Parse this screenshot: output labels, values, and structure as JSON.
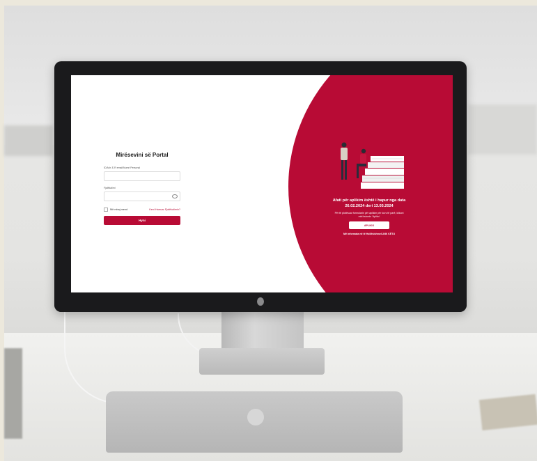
{
  "login": {
    "title": "Mirësevini së Portal",
    "username_label": "ID/Adr. E-R email/Numri Personal",
    "password_label": "Fjalëkalimi",
    "remember_label": "Më mbaj mend",
    "forgot_link": "Keni Harruar Fjalëkalimin?",
    "submit_label": "Hyni"
  },
  "promo": {
    "headline_line1": "Afati për aplikim është i hapur nga data",
    "headline_line2": "26.02.2024 deri 13.05.2024",
    "subtext_line1": "Për të plotësuar formularin për aplikim për kurs të parë, klikoni",
    "subtext_line2": "mbi butonin 'Apliko'",
    "apply_button": "APLIKO",
    "footer": "Më informata në të Hollësishme/LINK KËTU"
  },
  "colors": {
    "accent": "#b80b35",
    "bezel": "#1a1a1c"
  }
}
